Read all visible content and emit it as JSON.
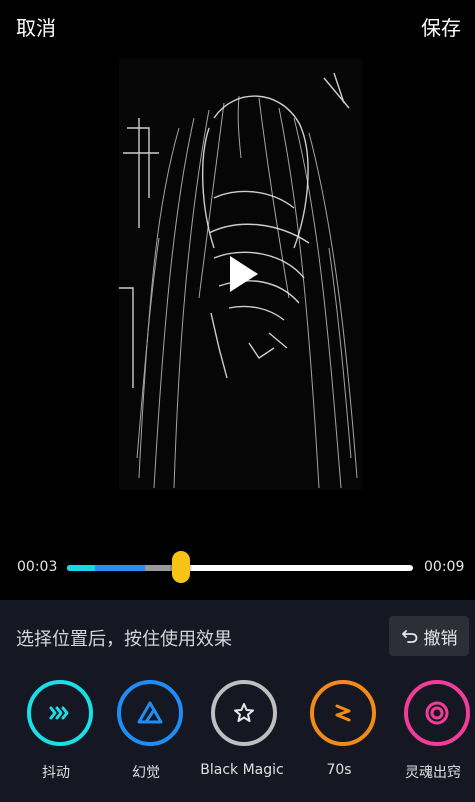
{
  "header": {
    "cancel_label": "取消",
    "save_label": "保存"
  },
  "player": {
    "current_time": "00:03",
    "total_time": "00:09",
    "playhead_fraction": 0.33
  },
  "panel": {
    "hint_text": "选择位置后，按住使用效果",
    "undo_label": "撤销"
  },
  "effects": [
    {
      "label": "抖动",
      "color": "#19e0e6",
      "icon": "shake-icon"
    },
    {
      "label": "幻觉",
      "color": "#1e8ef5",
      "icon": "triangle-icon"
    },
    {
      "label": "Black Magic",
      "color": "#bfbfbf",
      "icon": "star-icon"
    },
    {
      "label": "70s",
      "color": "#f28a18",
      "icon": "seventies-icon"
    },
    {
      "label": "灵魂出窍",
      "color": "#f23c9a",
      "icon": "soul-ring-icon"
    }
  ],
  "colors": {
    "background": "#000000",
    "panel": "#151722",
    "thumb": "#f7c416",
    "track_cyan": "#16d8e8",
    "track_blue": "#2a8cf0"
  }
}
